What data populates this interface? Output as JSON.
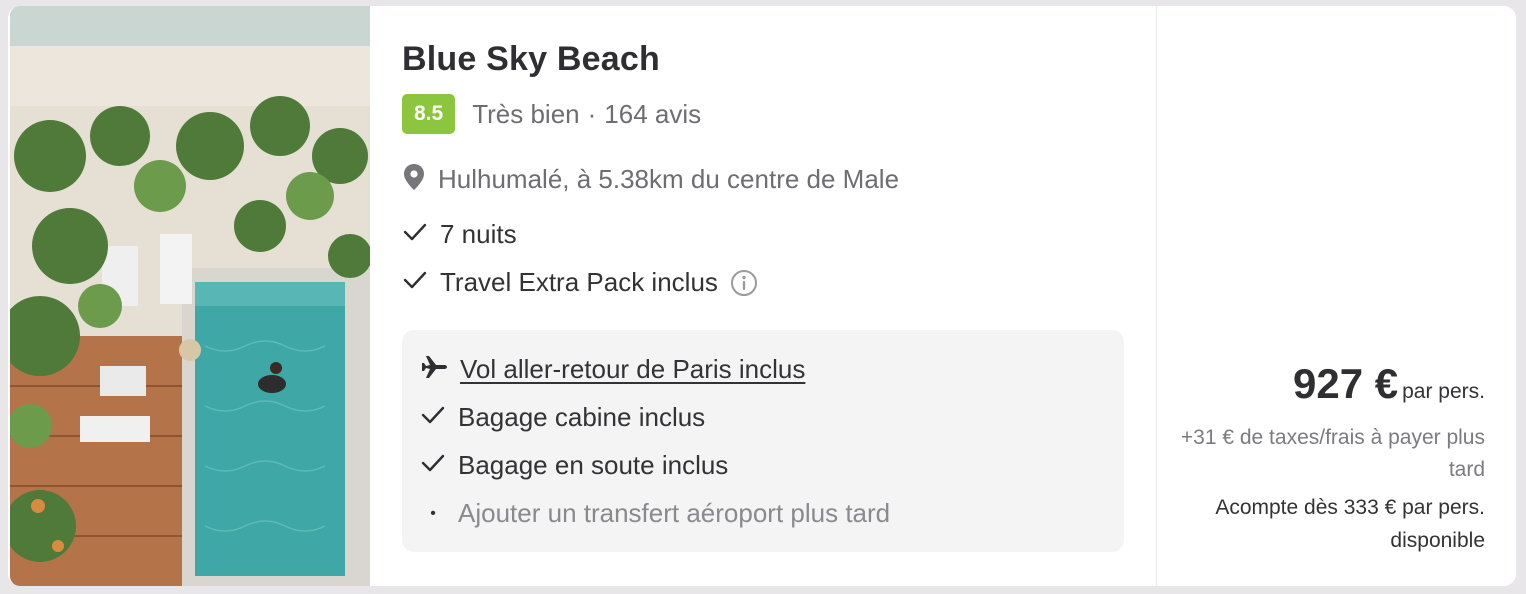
{
  "hotel": {
    "name": "Blue Sky Beach",
    "score": "8.5",
    "rating_label": "Très bien",
    "rating_separator": "·",
    "reviews": "164 avis",
    "location": "Hulhumalé, à 5.38km du centre de Male"
  },
  "features": [
    {
      "label": "7 nuits",
      "icon": "check-icon"
    },
    {
      "label": "Travel Extra Pack inclus",
      "icon": "check-icon",
      "info_icon": "info-icon"
    }
  ],
  "flight": {
    "items": [
      {
        "label": "Vol aller-retour de Paris inclus",
        "icon": "plane-icon"
      },
      {
        "label": "Bagage cabine inclus",
        "icon": "check-icon"
      },
      {
        "label": "Bagage en soute inclus",
        "icon": "check-icon"
      },
      {
        "label": "Ajouter un transfert aéroport plus tard",
        "icon": "bullet-dot"
      }
    ]
  },
  "price": {
    "amount": "927 €",
    "unit": "par pers.",
    "taxes": "+31 € de taxes/frais à payer plus tard",
    "deposit": "Acompte dès 333 € par pers. disponible"
  },
  "colors": {
    "score_badge": "#8cc63f",
    "pool": "#3fa7a6",
    "sand": "#ece6dc",
    "deck": "#b5734a"
  }
}
